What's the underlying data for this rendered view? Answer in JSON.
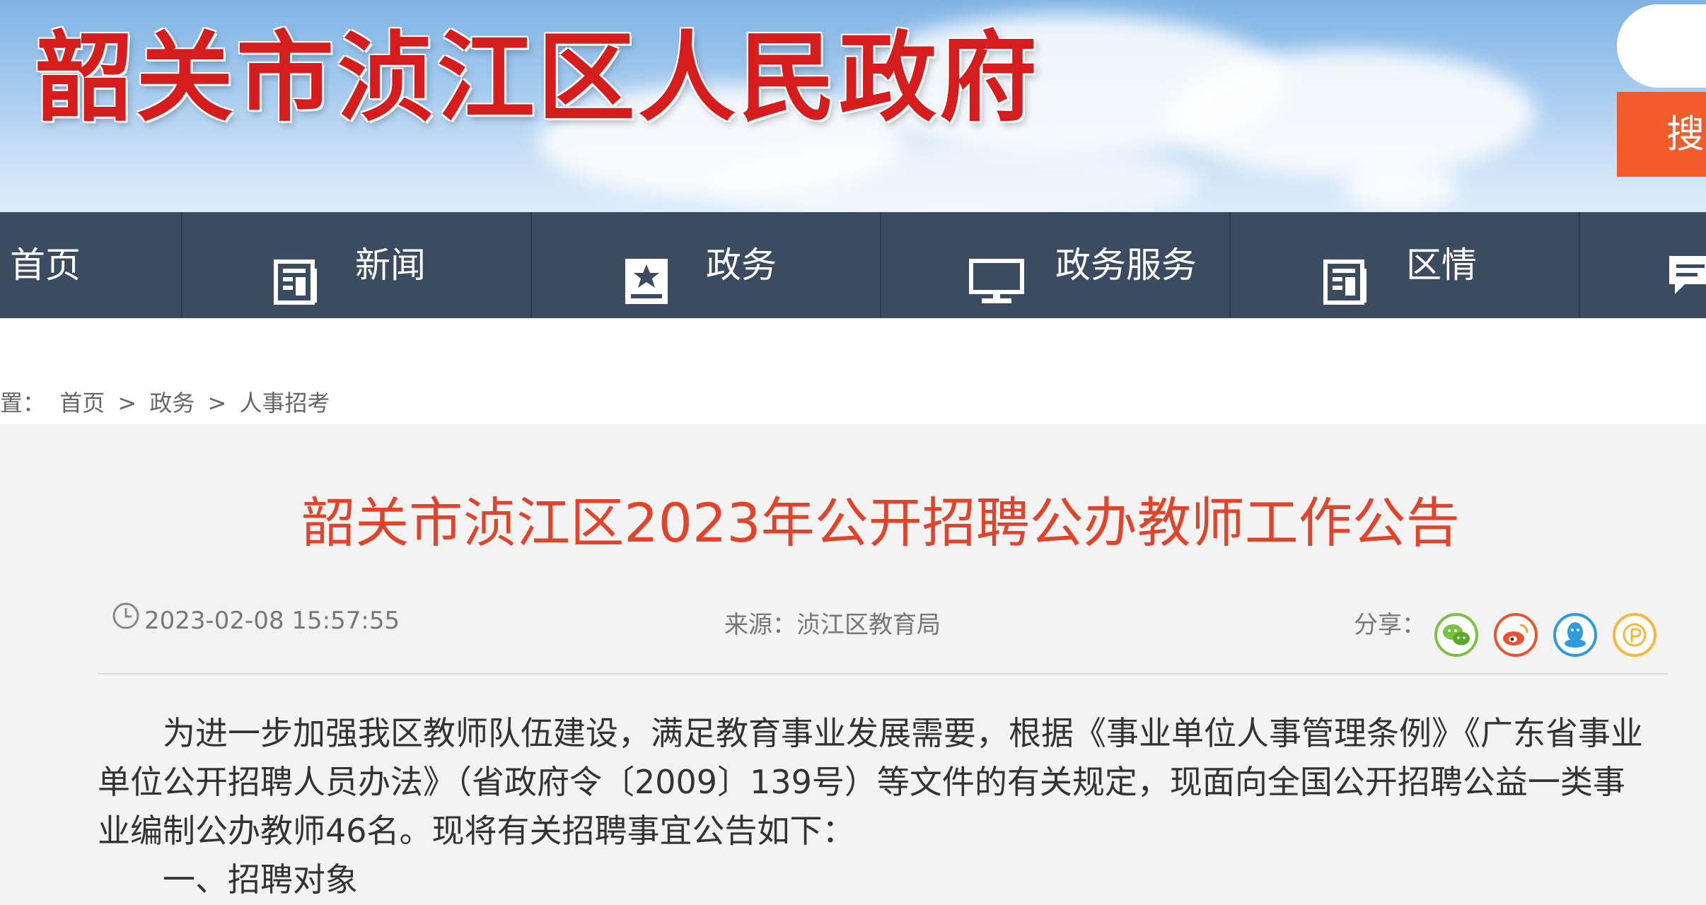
{
  "header": {
    "site_title": "韶关市浈江区人民政府",
    "search_button": "搜"
  },
  "nav": {
    "items": [
      {
        "label": "首页"
      },
      {
        "label": "新闻",
        "icon": "newspaper-icon"
      },
      {
        "label": "政务",
        "icon": "star-badge-icon"
      },
      {
        "label": "政务服务",
        "icon": "monitor-icon"
      },
      {
        "label": "区情",
        "icon": "newspaper-icon"
      }
    ]
  },
  "breadcrumb": {
    "prefix": "置：",
    "items": [
      "首页",
      "政务",
      "人事招考"
    ],
    "separator": ">"
  },
  "article": {
    "title": "韶关市浈江区2023年公开招聘公办教师工作公告",
    "date": "2023-02-08 15:57:55",
    "source": "来源：浈江区教育局",
    "share_label": "分享：",
    "share_icons": [
      "wechat-icon",
      "weibo-icon",
      "qq-icon",
      "qzone-icon"
    ],
    "paragraph1": "为进一步加强我区教师队伍建设，满足教育事业发展需要，根据《事业单位人事管理条例》《广东省事业单位公开招聘人员办法》（省政府令〔2009〕139号）等文件的有关规定，现面向全国公开招聘公益一类事业编制公办教师46名。现将有关招聘事宜公告如下：",
    "section1": "一、招聘对象"
  },
  "colors": {
    "nav_bg": "#3b4c60",
    "title_red": "#e0452c",
    "search_orange": "#f35c2a",
    "site_title_red": "#d61d1d"
  }
}
